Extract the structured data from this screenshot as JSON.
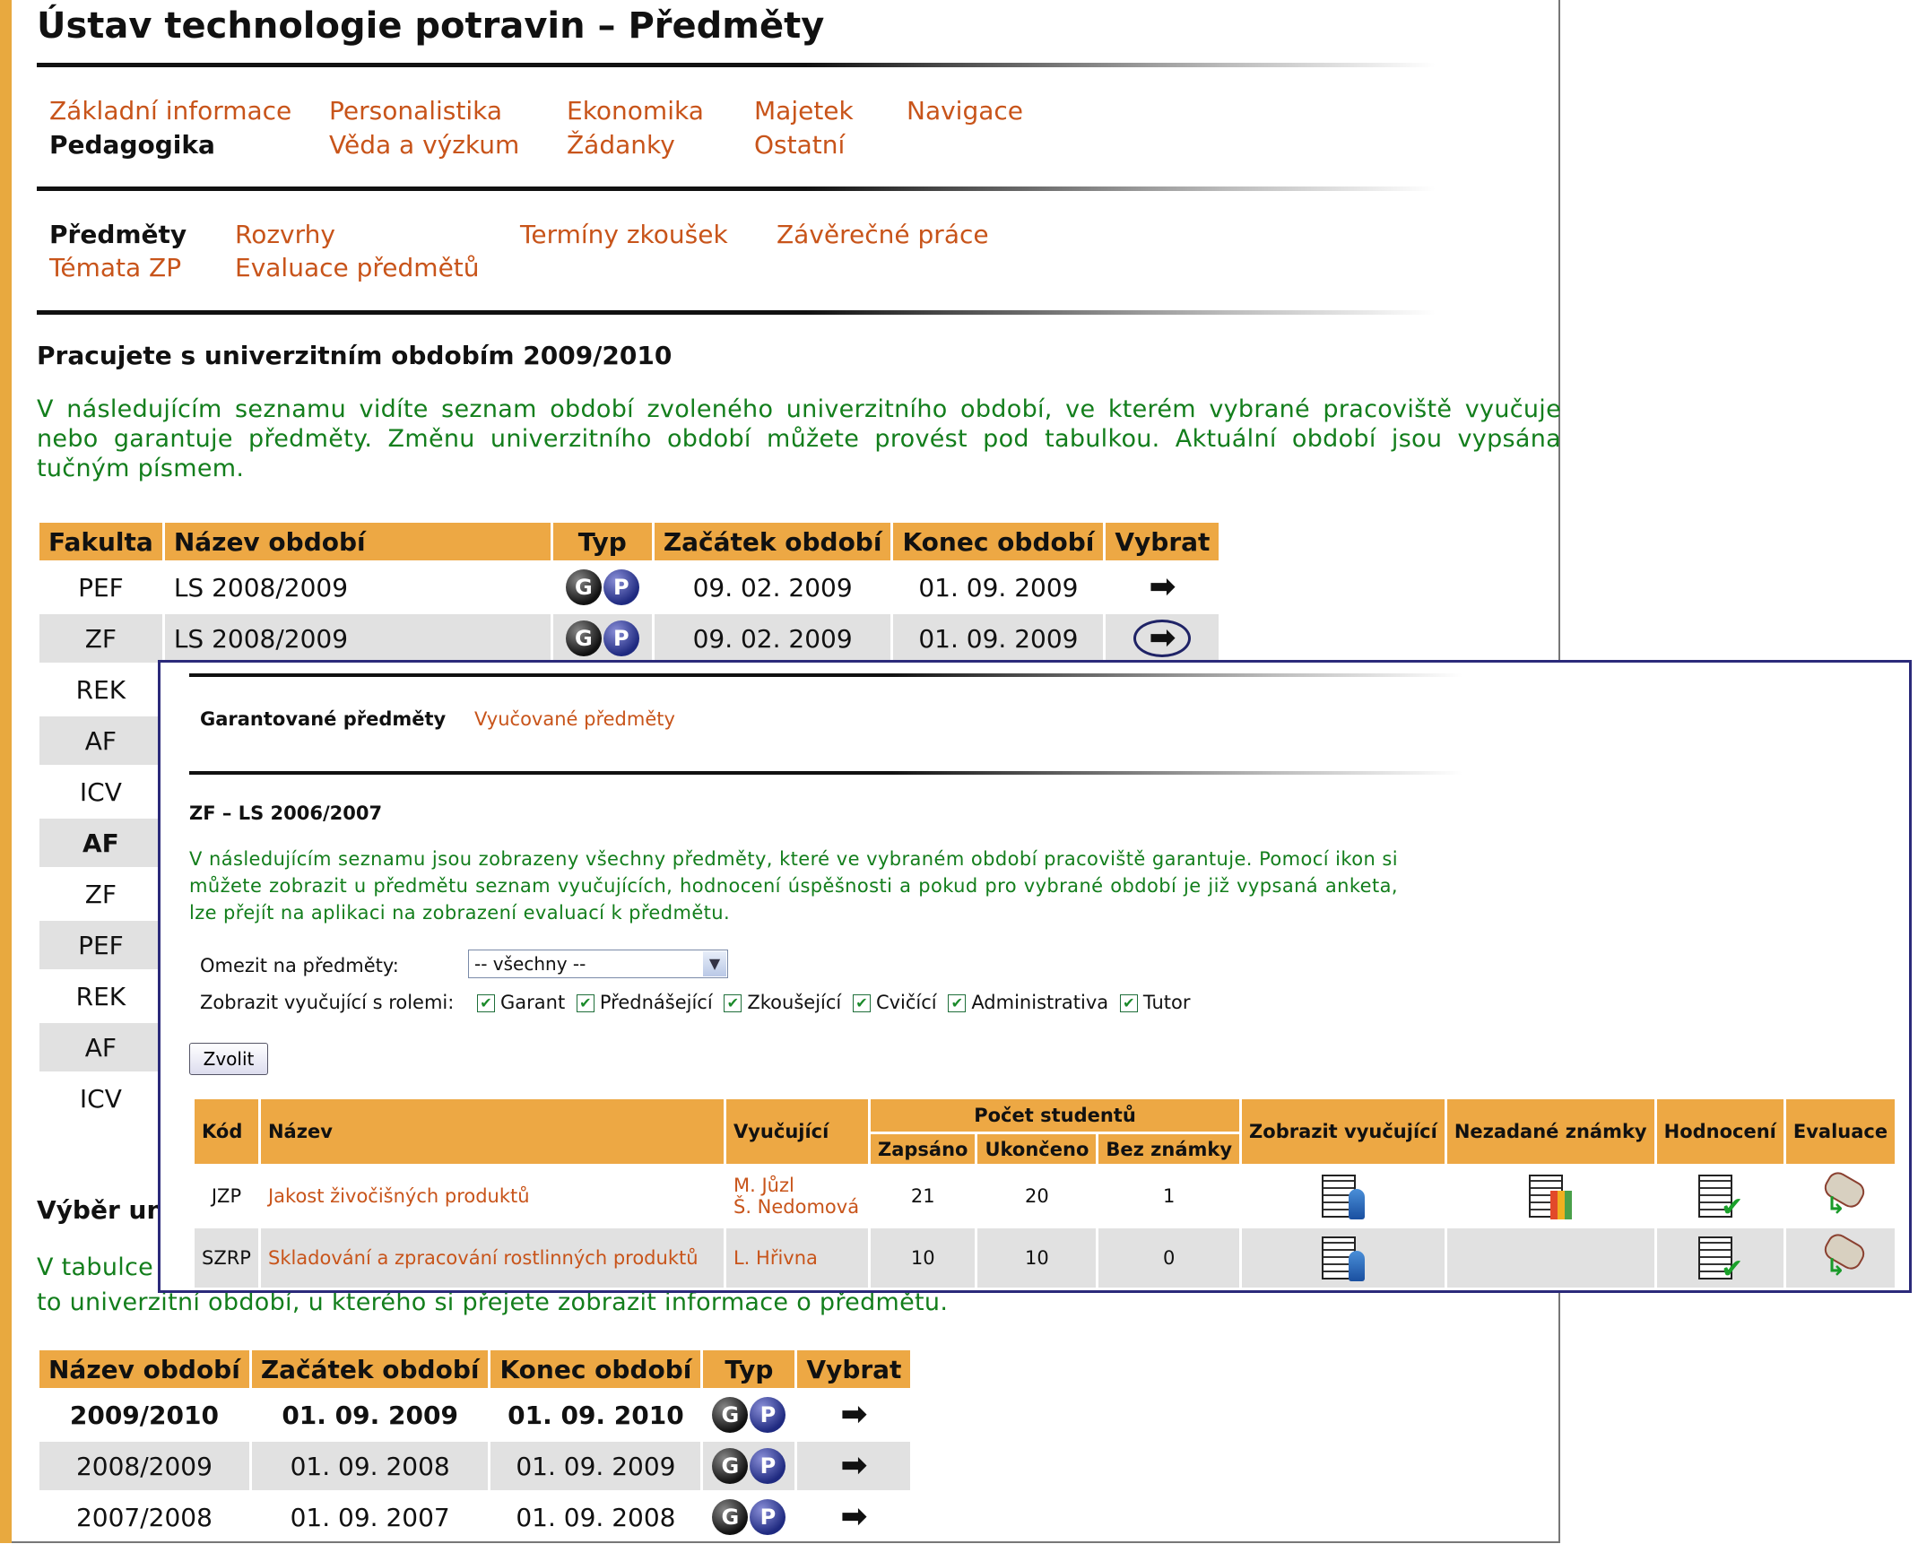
{
  "title": "Ústav technologie potravin – Předměty",
  "menu": {
    "main": [
      "Základní informace",
      "Personalistika",
      "Ekonomika",
      "Majetek",
      "Navigace",
      "Pedagogika",
      "Věda a výzkum",
      "Žádanky",
      "Ostatní"
    ],
    "sub": [
      "Předměty",
      "Rozvrhy",
      "Termíny zkoušek",
      "Závěrečné práce",
      "Témata ZP",
      "Evaluace předmětů"
    ]
  },
  "period_heading": "Pracujete s univerzitním obdobím 2009/2010",
  "period_intro": "V následujícím seznamu vidíte seznam období zvoleného univerzitního období, ve kterém vybrané pracoviště vyučuje nebo garantuje předměty. Změnu univerzitního období můžete provést pod tabulkou. Aktuální období jsou vypsána tučným písmem.",
  "periods_table": {
    "headers": [
      "Fakulta",
      "Název období",
      "Typ",
      "Začátek období",
      "Konec období",
      "Vybrat"
    ],
    "type_icons": [
      "G",
      "P"
    ],
    "rows": [
      {
        "fakulta": "PEF",
        "nazev": "LS 2008/2009",
        "zacatek": "09. 02. 2009",
        "konec": "01. 09. 2009"
      },
      {
        "fakulta": "ZF",
        "nazev": "LS 2008/2009",
        "zacatek": "09. 02. 2009",
        "konec": "01. 09. 2009"
      }
    ],
    "fakulty_visible": [
      "REK",
      "AF",
      "ICV",
      "AF",
      "ZF",
      "PEF",
      "REK",
      "AF",
      "ICV"
    ]
  },
  "lower": {
    "heading_fragment": "Výběr un",
    "intro_fragment_1": "V tabulce",
    "intro_fragment_2": "to univerzitní období, u kterého si přejete zobrazit informace o předmětu.",
    "years_table": {
      "headers": [
        "Název období",
        "Začátek období",
        "Konec období",
        "Typ",
        "Vybrat"
      ],
      "rows": [
        {
          "nazev": "2009/2010",
          "zacatek": "01. 09. 2009",
          "konec": "01. 09. 2010"
        },
        {
          "nazev": "2008/2009",
          "zacatek": "01. 09. 2008",
          "konec": "01. 09. 2009"
        },
        {
          "nazev": "2007/2008",
          "zacatek": "01. 09. 2007",
          "konec": "01. 09. 2008"
        }
      ]
    }
  },
  "popup": {
    "tabs": [
      "Garantované předměty",
      "Vyučované předměty"
    ],
    "heading": "ZF – LS 2006/2007",
    "intro": "V následujícím seznamu jsou zobrazeny všechny předměty, které ve vybraném období pracoviště garantuje. Pomocí ikon si můžete zobrazit u předmětu seznam vyučujících, hodnocení úspěšnosti a pokud pro vybrané období je již vypsaná anketa, lze přejít na aplikaci na zobrazení evaluací k předmětu.",
    "filter_label": "Omezit na předměty:",
    "filter_value": "-- všechny --",
    "roles_label": "Zobrazit vyučující s rolemi:",
    "roles": [
      "Garant",
      "Přednášející",
      "Zkoušející",
      "Cvičící",
      "Administrativa",
      "Tutor"
    ],
    "submit": "Zvolit",
    "table": {
      "headers": [
        "Kód",
        "Název",
        "Vyučující",
        "Počet studentů",
        "Zobrazit vyučující",
        "Nezadané známky",
        "Hodnocení",
        "Evaluace"
      ],
      "subheaders": [
        "Zapsáno",
        "Ukončeno",
        "Bez známky"
      ],
      "rows": [
        {
          "kod": "JZP",
          "nazev": "Jakost živočišných produktů",
          "vyucujici_1": "M. Jůzl",
          "vyucujici_2": "Š. Nedomová",
          "zapsano": "21",
          "ukonceno": "20",
          "bez": "1"
        },
        {
          "kod": "SZRP",
          "nazev": "Skladování a zpracování rostlinných produktů",
          "vyucujici_1": "L. Hřivna",
          "zapsano": "10",
          "ukonceno": "10",
          "bez": "0"
        }
      ]
    }
  },
  "colors": {
    "accent": "#EDA844",
    "link": "#C8541A",
    "intro_text": "#137e1c",
    "popup_border": "#2B2A7A"
  }
}
